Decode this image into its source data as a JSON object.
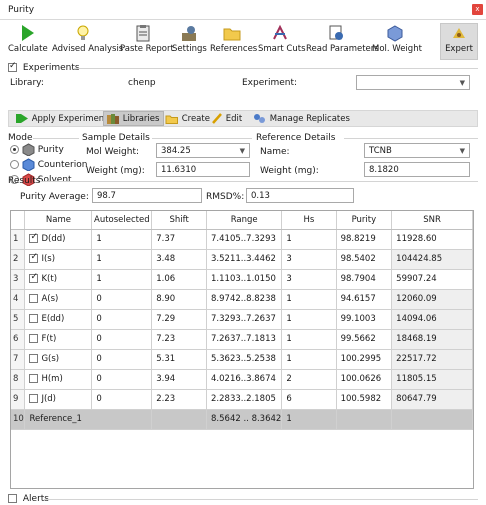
{
  "window": {
    "title": "Purity",
    "close_label": "x"
  },
  "toolbar": [
    {
      "label": "Calculate",
      "icon": "play-icon"
    },
    {
      "label": "Advised Analysis",
      "icon": "lightbulb-icon"
    },
    {
      "label": "Paste Report",
      "icon": "clipboard-icon"
    },
    {
      "label": "Settings",
      "icon": "settings-icon"
    },
    {
      "label": "References",
      "icon": "folder-icon"
    },
    {
      "label": "Smart Cuts",
      "icon": "smart-cuts-icon"
    },
    {
      "label": "Read Parameters",
      "icon": "read-parameters-icon"
    },
    {
      "label": "Mol. Weight",
      "icon": "molecule-icon"
    },
    {
      "label": "Expert",
      "icon": "expert-icon"
    }
  ],
  "experiments": {
    "section_label": "Experiments",
    "checked": true,
    "library_label": "Library:",
    "library_value": "chenp",
    "experiment_label": "Experiment:",
    "experiment_value": ""
  },
  "actions": {
    "apply": "Apply Experiment",
    "libraries": "Libraries",
    "create": "Create",
    "edit": "Edit",
    "manage": "Manage Replicates"
  },
  "mode": {
    "section_label": "Mode",
    "options": [
      "Purity",
      "Counterion",
      "Solvent"
    ],
    "selected": "Purity"
  },
  "sample": {
    "section_label": "Sample Details",
    "mol_weight_label": "Mol Weight:",
    "mol_weight_value": "384.25",
    "weight_label": "Weight (mg):",
    "weight_value": "11.6310"
  },
  "reference": {
    "section_label": "Reference Details",
    "name_label": "Name:",
    "name_value": "TCNB",
    "weight_label": "Weight (mg):",
    "weight_value": "8.1820"
  },
  "results": {
    "section_label": "Results",
    "purity_avg_label": "Purity Average:",
    "purity_avg_value": "98.7",
    "rmsd_label": "RMSD%:",
    "rmsd_value": "0.13"
  },
  "table": {
    "columns": [
      "",
      "Name",
      "Autoselected",
      "Shift",
      "Range",
      "Hs",
      "Purity",
      "SNR"
    ],
    "rows": [
      {
        "n": "1",
        "checked": true,
        "name": "D(dd)",
        "auto": "1",
        "shift": "7.37",
        "range": "7.4105..7.3293",
        "hs": "1",
        "purity": "98.8219",
        "snr": "11928.60"
      },
      {
        "n": "2",
        "checked": true,
        "name": "I(s)",
        "auto": "1",
        "shift": "3.48",
        "range": "3.5211..3.4462",
        "hs": "3",
        "purity": "98.5402",
        "snr": "104424.85"
      },
      {
        "n": "3",
        "checked": true,
        "name": "K(t)",
        "auto": "1",
        "shift": "1.06",
        "range": "1.1103..1.0150",
        "hs": "3",
        "purity": "98.7904",
        "snr": "59907.24"
      },
      {
        "n": "4",
        "checked": false,
        "name": "A(s)",
        "auto": "0",
        "shift": "8.90",
        "range": "8.9742..8.8238",
        "hs": "1",
        "purity": "94.6157",
        "snr": "12060.09"
      },
      {
        "n": "5",
        "checked": false,
        "name": "E(dd)",
        "auto": "0",
        "shift": "7.29",
        "range": "7.3293..7.2637",
        "hs": "1",
        "purity": "99.1003",
        "snr": "14094.06"
      },
      {
        "n": "6",
        "checked": false,
        "name": "F(t)",
        "auto": "0",
        "shift": "7.23",
        "range": "7.2637..7.1813",
        "hs": "1",
        "purity": "99.5662",
        "snr": "18468.19"
      },
      {
        "n": "7",
        "checked": false,
        "name": "G(s)",
        "auto": "0",
        "shift": "5.31",
        "range": "5.3623..5.2538",
        "hs": "1",
        "purity": "100.2995",
        "snr": "22517.72"
      },
      {
        "n": "8",
        "checked": false,
        "name": "H(m)",
        "auto": "0",
        "shift": "3.94",
        "range": "4.0216..3.8674",
        "hs": "2",
        "purity": "100.0626",
        "snr": "11805.15"
      },
      {
        "n": "9",
        "checked": false,
        "name": "J(d)",
        "auto": "0",
        "shift": "2.23",
        "range": "2.2833..2.1805",
        "hs": "6",
        "purity": "100.5982",
        "snr": "80647.79"
      }
    ],
    "reference_row": {
      "n": "10",
      "name": "Reference_1",
      "range": "8.5642 .. 8.3642",
      "hs": "1"
    }
  },
  "alerts": {
    "label": "Alerts",
    "checked": false
  },
  "colors": {
    "close": "#e2453c",
    "play": "#2aa52a",
    "reference_row": "#c8c8c8"
  }
}
